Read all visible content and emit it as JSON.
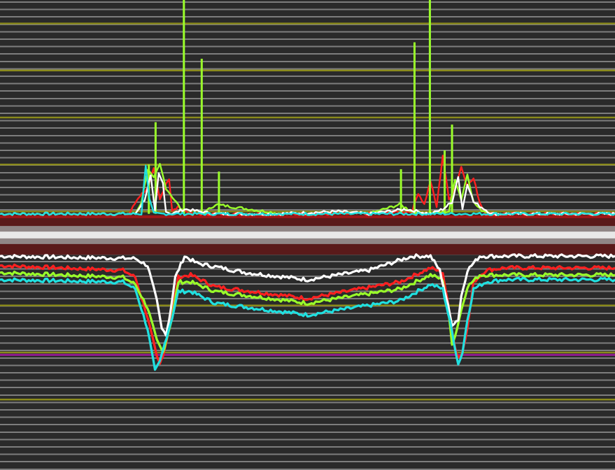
{
  "colors": {
    "background": "#2a2a2a",
    "grid_minor": "#7d7d7d",
    "grid_major": "#8a8a1c",
    "reference_line": "#8e1a8e",
    "baseline_band": "#5a1a1a",
    "baseline_stripe": "#9a9a9a",
    "baseline_core": "#e8e8e8"
  },
  "chart_data": {
    "type": "line",
    "title": "",
    "xlabel": "",
    "ylabel": "",
    "xlim": [
      0,
      100
    ],
    "ylim": [
      -10,
      10
    ],
    "grid": true,
    "legend": "none",
    "major_grid_y": [
      9,
      7,
      5,
      3,
      1,
      -3,
      -5,
      -7
    ],
    "reference_line_y": -5.1,
    "baseline_band": {
      "y_top": 0.6,
      "y_bottom": -0.6
    },
    "series": [
      {
        "color": "#ff2020",
        "upper": {
          "x": [
            0,
            21,
            22.5,
            24,
            25,
            26,
            27,
            27.5,
            28,
            29,
            31,
            46,
            56,
            60,
            67,
            68,
            69,
            70,
            71,
            72,
            73,
            74,
            75,
            76,
            77,
            78,
            79,
            80,
            82,
            100
          ],
          "y": [
            0.9,
            0.9,
            1.6,
            2.0,
            2.8,
            1.5,
            2.2,
            2.4,
            1.0,
            1.2,
            0.9,
            0.9,
            0.9,
            0.9,
            1.0,
            1.8,
            1.3,
            2.3,
            1.2,
            3.4,
            1.5,
            2.0,
            2.9,
            2.1,
            2.4,
            1.4,
            0.9,
            0.9,
            0.9,
            0.9
          ]
        },
        "lower": {
          "x": [
            0,
            20,
            22,
            24,
            25.5,
            26,
            26.5,
            27,
            28,
            29,
            31,
            35,
            50,
            65,
            70,
            72,
            73,
            74,
            74.5,
            75,
            76,
            77,
            79,
            82,
            100
          ],
          "y": [
            -1.3,
            -1.5,
            -1.8,
            -3.5,
            -5.2,
            -5.5,
            -5.1,
            -4.6,
            -3.2,
            -1.8,
            -1.7,
            -2.2,
            -2.7,
            -2.0,
            -1.4,
            -1.6,
            -3.2,
            -4.8,
            -5.2,
            -5.1,
            -4.0,
            -2.0,
            -1.5,
            -1.4,
            -1.4
          ]
        }
      },
      {
        "color": "#9aff2a",
        "upper": {
          "x": [
            0,
            22,
            23,
            24,
            25,
            26,
            27,
            30,
            33,
            35,
            46,
            56,
            60,
            65,
            67,
            70,
            73,
            74,
            75,
            76,
            77,
            78,
            80,
            100
          ],
          "y": [
            0.9,
            0.9,
            1.4,
            2.8,
            2.4,
            3.0,
            2.0,
            0.9,
            0.9,
            1.3,
            0.9,
            0.9,
            0.9,
            1.3,
            1.0,
            0.9,
            1.0,
            2.4,
            1.5,
            2.6,
            1.4,
            1.1,
            0.9,
            0.9
          ]
        },
        "lower": {
          "x": [
            0,
            20,
            22,
            24,
            25.5,
            26.5,
            27,
            28,
            29,
            31,
            35,
            50,
            65,
            70,
            72,
            73,
            73.5,
            74,
            75,
            76,
            78,
            82,
            100
          ],
          "y": [
            -1.6,
            -1.8,
            -2.1,
            -3.1,
            -4.5,
            -5.0,
            -4.5,
            -3.5,
            -2.0,
            -2.0,
            -2.4,
            -2.9,
            -2.3,
            -1.7,
            -1.9,
            -3.5,
            -4.6,
            -4.3,
            -3.2,
            -2.2,
            -1.7,
            -1.7,
            -1.7
          ]
        },
        "spikes": [
          {
            "x": 25.3,
            "y": 4.8
          },
          {
            "x": 29.9,
            "y": 11.5
          },
          {
            "x": 32.8,
            "y": 7.5
          },
          {
            "x": 35.6,
            "y": 2.7
          },
          {
            "x": 65.2,
            "y": 2.8
          },
          {
            "x": 67.4,
            "y": 8.2
          },
          {
            "x": 69.9,
            "y": 12.5
          },
          {
            "x": 73.5,
            "y": 4.7
          },
          {
            "x": 24.2,
            "y": 3.0
          },
          {
            "x": 72.3,
            "y": 3.6
          }
        ]
      },
      {
        "color": "#ffffff",
        "upper": {
          "x": [
            0,
            22,
            23.5,
            24.5,
            25.2,
            25.8,
            26.5,
            27,
            28,
            30,
            35,
            45,
            55,
            60,
            66,
            70,
            72,
            73.5,
            74.5,
            75.2,
            76,
            77,
            80,
            100
          ],
          "y": [
            0.9,
            0.9,
            1.5,
            2.5,
            1.0,
            2.6,
            2.2,
            1.0,
            0.9,
            1.1,
            0.9,
            0.9,
            1.0,
            0.9,
            1.1,
            0.9,
            1.1,
            1.4,
            2.5,
            1.1,
            2.2,
            1.4,
            0.9,
            0.9
          ]
        },
        "lower": {
          "x": [
            0,
            22,
            24,
            25.5,
            26.3,
            27,
            27.5,
            28.5,
            30,
            32,
            40,
            50,
            60,
            67,
            70,
            71.5,
            72.5,
            73.5,
            74.5,
            75,
            76,
            78,
            100
          ],
          "y": [
            -0.9,
            -1.0,
            -1.3,
            -2.8,
            -4.0,
            -4.2,
            -3.6,
            -1.8,
            -0.9,
            -1.2,
            -1.6,
            -1.9,
            -1.5,
            -0.9,
            -0.9,
            -1.5,
            -2.6,
            -3.8,
            -3.6,
            -2.6,
            -1.5,
            -0.9,
            -0.9
          ]
        }
      },
      {
        "color": "#20e0e0",
        "upper": {
          "x": [
            0,
            23,
            23.7,
            24.3,
            25,
            100
          ],
          "y": [
            0.9,
            0.9,
            3.0,
            1.5,
            0.9,
            0.9
          ]
        },
        "lower": {
          "x": [
            0,
            20,
            22,
            24,
            25.2,
            26,
            26.8,
            28,
            29,
            31,
            35,
            50,
            65,
            70,
            72,
            73.5,
            74.5,
            75.2,
            76,
            77,
            79,
            82,
            100
          ],
          "y": [
            -1.9,
            -2.0,
            -2.3,
            -4.0,
            -5.8,
            -5.4,
            -4.6,
            -3.5,
            -2.4,
            -2.4,
            -2.9,
            -3.4,
            -2.8,
            -2.1,
            -2.3,
            -4.1,
            -5.5,
            -5.0,
            -3.6,
            -2.3,
            -2.0,
            -1.9,
            -1.9
          ]
        }
      }
    ]
  }
}
